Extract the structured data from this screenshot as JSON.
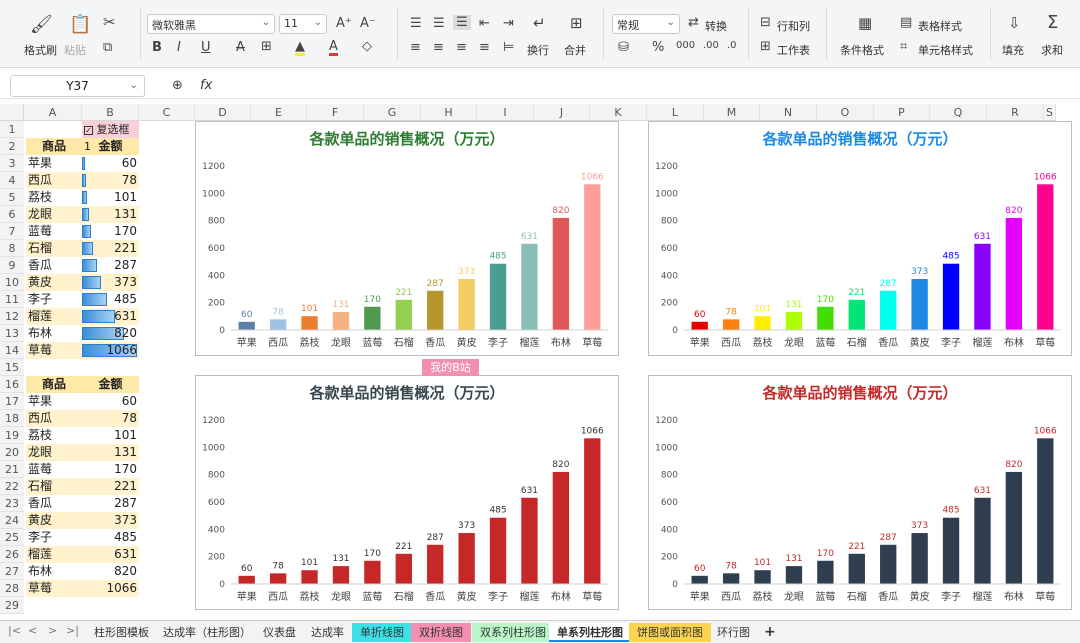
{
  "ribbon": {
    "format_painter": "格式刷",
    "paste": "粘贴",
    "font_name": "微软雅黑",
    "font_size": "11",
    "number_format": "常规",
    "convert": "转换",
    "wrap": "换行",
    "merge": "合并",
    "row_col": "行和列",
    "worksheet": "工作表",
    "cond_format": "条件格式",
    "table_style": "表格样式",
    "cell_style": "单元格样式",
    "fill": "填充",
    "sum": "求和"
  },
  "formula_bar": {
    "name_box": "Y37",
    "fx": "fx"
  },
  "columns": [
    "A",
    "B",
    "C",
    "D",
    "E",
    "F",
    "G",
    "H",
    "I",
    "J",
    "K",
    "L",
    "M",
    "N",
    "O",
    "P",
    "Q",
    "R",
    "S"
  ],
  "rows": [
    "1",
    "2",
    "3",
    "4",
    "5",
    "6",
    "7",
    "8",
    "9",
    "10",
    "11",
    "12",
    "13",
    "14",
    "15",
    "16",
    "17",
    "18",
    "19",
    "20",
    "21",
    "22",
    "23",
    "24",
    "25",
    "26",
    "27",
    "28",
    "29"
  ],
  "checkbox_label": "复选框 1",
  "table1": {
    "header": [
      "商品",
      "金额"
    ],
    "rows": [
      [
        "苹果",
        "60"
      ],
      [
        "西瓜",
        "78"
      ],
      [
        "荔枝",
        "101"
      ],
      [
        "龙眼",
        "131"
      ],
      [
        "蓝莓",
        "170"
      ],
      [
        "石榴",
        "221"
      ],
      [
        "香瓜",
        "287"
      ],
      [
        "黄皮",
        "373"
      ],
      [
        "李子",
        "485"
      ],
      [
        "榴莲",
        "631"
      ],
      [
        "布林",
        "820"
      ],
      [
        "草莓",
        "1066"
      ]
    ]
  },
  "table2": {
    "header": [
      "商品",
      "金额"
    ],
    "rows": [
      [
        "苹果",
        "60"
      ],
      [
        "西瓜",
        "78"
      ],
      [
        "荔枝",
        "101"
      ],
      [
        "龙眼",
        "131"
      ],
      [
        "蓝莓",
        "170"
      ],
      [
        "石榴",
        "221"
      ],
      [
        "香瓜",
        "287"
      ],
      [
        "黄皮",
        "373"
      ],
      [
        "李子",
        "485"
      ],
      [
        "榴莲",
        "631"
      ],
      [
        "布林",
        "820"
      ],
      [
        "草莓",
        "1066"
      ]
    ]
  },
  "bilibili_label": "我的B站",
  "chart_data": [
    {
      "type": "bar",
      "title": "各款单品的销售概况（万元）",
      "title_color": "#2e7d32",
      "categories": [
        "苹果",
        "西瓜",
        "荔枝",
        "龙眼",
        "蓝莓",
        "石榴",
        "香瓜",
        "黄皮",
        "李子",
        "榴莲",
        "布林",
        "草莓"
      ],
      "values": [
        60,
        78,
        101,
        131,
        170,
        221,
        287,
        373,
        485,
        631,
        820,
        1066
      ],
      "colors": [
        "#5b7fa8",
        "#9dc3e6",
        "#ed7d31",
        "#f4b183",
        "#4f9a4f",
        "#92d050",
        "#b8962e",
        "#f2cd61",
        "#4a9d94",
        "#86c0b9",
        "#e15759",
        "#ff9d9a"
      ],
      "yticks": [
        0,
        200,
        400,
        600,
        800,
        1000,
        1200
      ],
      "ylim": [
        0,
        1200
      ]
    },
    {
      "type": "bar",
      "title": "各款单品的销售概况（万元）",
      "title_color": "#1e88e5",
      "categories": [
        "苹果",
        "西瓜",
        "荔枝",
        "龙眼",
        "蓝莓",
        "石榴",
        "香瓜",
        "黄皮",
        "李子",
        "榴莲",
        "布林",
        "草莓"
      ],
      "values": [
        60,
        78,
        101,
        131,
        170,
        221,
        287,
        373,
        485,
        631,
        820,
        1066
      ],
      "colors": [
        "#e60000",
        "#ff7f0e",
        "#ffee00",
        "#aaff00",
        "#44dd00",
        "#00e676",
        "#00ffee",
        "#1e88e5",
        "#0000ff",
        "#8a00ff",
        "#e600ff",
        "#ff0090"
      ],
      "yticks": [
        0,
        200,
        400,
        600,
        800,
        1000,
        1200
      ],
      "ylim": [
        0,
        1200
      ]
    },
    {
      "type": "bar",
      "title": "各款单品的销售概况（万元）",
      "title_color": "#37474f",
      "categories": [
        "苹果",
        "西瓜",
        "荔枝",
        "龙眼",
        "蓝莓",
        "石榴",
        "香瓜",
        "黄皮",
        "李子",
        "榴莲",
        "布林",
        "草莓"
      ],
      "values": [
        60,
        78,
        101,
        131,
        170,
        221,
        287,
        373,
        485,
        631,
        820,
        1066
      ],
      "colors": [
        "#c62828"
      ],
      "label_color": "#333333",
      "yticks": [
        0,
        200,
        400,
        600,
        800,
        1000,
        1200
      ],
      "ylim": [
        0,
        1200
      ]
    },
    {
      "type": "bar",
      "title": "各款单品的销售概况（万元）",
      "title_color": "#c62828",
      "categories": [
        "苹果",
        "西瓜",
        "荔枝",
        "龙眼",
        "蓝莓",
        "石榴",
        "香瓜",
        "黄皮",
        "李子",
        "榴莲",
        "布林",
        "草莓"
      ],
      "values": [
        60,
        78,
        101,
        131,
        170,
        221,
        287,
        373,
        485,
        631,
        820,
        1066
      ],
      "colors": [
        "#2f3f4f"
      ],
      "label_color": "#c62828",
      "yticks": [
        0,
        200,
        400,
        600,
        800,
        1000,
        1200
      ],
      "ylim": [
        0,
        1200
      ]
    }
  ],
  "sheet_tabs": [
    {
      "label": "柱形图模板",
      "bg": ""
    },
    {
      "label": "达成率（柱形图）",
      "bg": ""
    },
    {
      "label": "仪表盘",
      "bg": ""
    },
    {
      "label": "达成率",
      "bg": ""
    },
    {
      "label": "单折线图",
      "bg": "#3ee0e8"
    },
    {
      "label": "双折线图",
      "bg": "#f48fb1"
    },
    {
      "label": "双系列柱形图",
      "bg": "#b9f6ca"
    },
    {
      "label": "单系列柱形图",
      "bg": "#ffffff"
    },
    {
      "label": "饼图或面积图",
      "bg": "#ffd54f"
    },
    {
      "label": "环行图",
      "bg": ""
    }
  ],
  "add_sheet": "+"
}
